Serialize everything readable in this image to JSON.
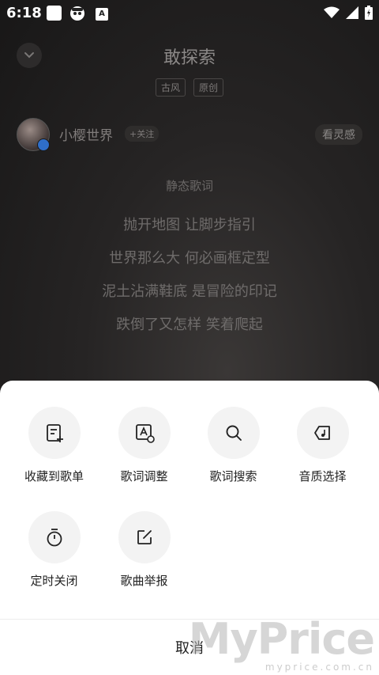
{
  "status_bar": {
    "time": "6:18"
  },
  "player": {
    "song_title": "敢探索",
    "tags": [
      "古风",
      "原创"
    ],
    "artist": {
      "name": "小樱世界",
      "follow_label": "+关注",
      "inspire_label": "看灵感"
    },
    "lyrics_heading": "静态歌词",
    "lyrics": [
      "抛开地图 让脚步指引",
      "世界那么大 何必画框定型",
      "泥土沾满鞋底 是冒险的印记",
      "跌倒了又怎样 笑着爬起"
    ]
  },
  "sheet": {
    "actions": [
      {
        "label": "收藏到歌单",
        "icon": "add-to-playlist-icon"
      },
      {
        "label": "歌词调整",
        "icon": "lyric-adjust-icon"
      },
      {
        "label": "歌词搜索",
        "icon": "search-icon"
      },
      {
        "label": "音质选择",
        "icon": "sound-quality-icon"
      },
      {
        "label": "定时关闭",
        "icon": "timer-icon"
      },
      {
        "label": "歌曲举报",
        "icon": "report-icon"
      }
    ],
    "cancel_label": "取消"
  },
  "watermark": {
    "brand": "MyPrice",
    "url": "myprice.com.cn"
  }
}
